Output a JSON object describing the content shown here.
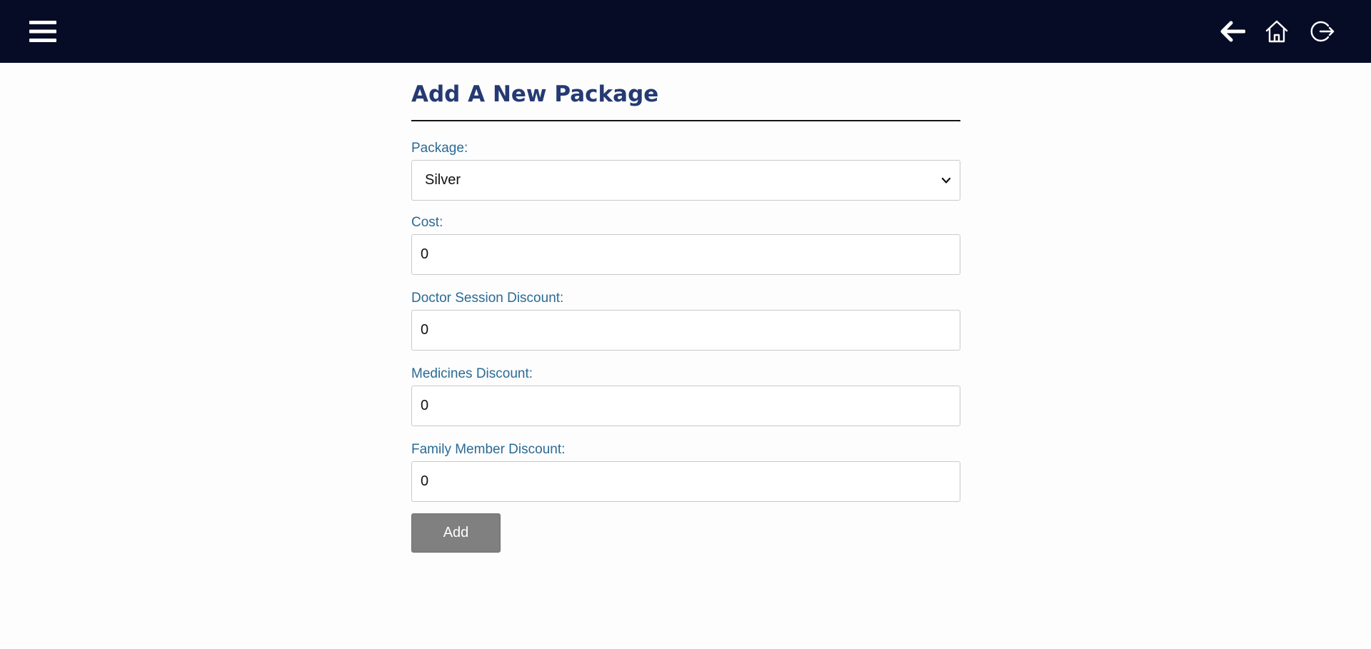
{
  "header": {
    "menu_icon": "hamburger-menu-icon",
    "back_icon": "arrow-left-icon",
    "home_icon": "home-icon",
    "logout_icon": "logout-icon",
    "background": "#070c26"
  },
  "form": {
    "title": "Add A New Package",
    "package": {
      "label": "Package:",
      "value": "Silver"
    },
    "cost": {
      "label": "Cost:",
      "value": "0"
    },
    "doctor_session_discount": {
      "label": "Doctor Session Discount:",
      "value": "0"
    },
    "medicines_discount": {
      "label": "Medicines Discount:",
      "value": "0"
    },
    "family_member_discount": {
      "label": "Family Member Discount:",
      "value": "0"
    },
    "submit_label": "Add"
  },
  "colors": {
    "title": "#253a73",
    "label": "#2a6a95",
    "button": "#808080"
  }
}
